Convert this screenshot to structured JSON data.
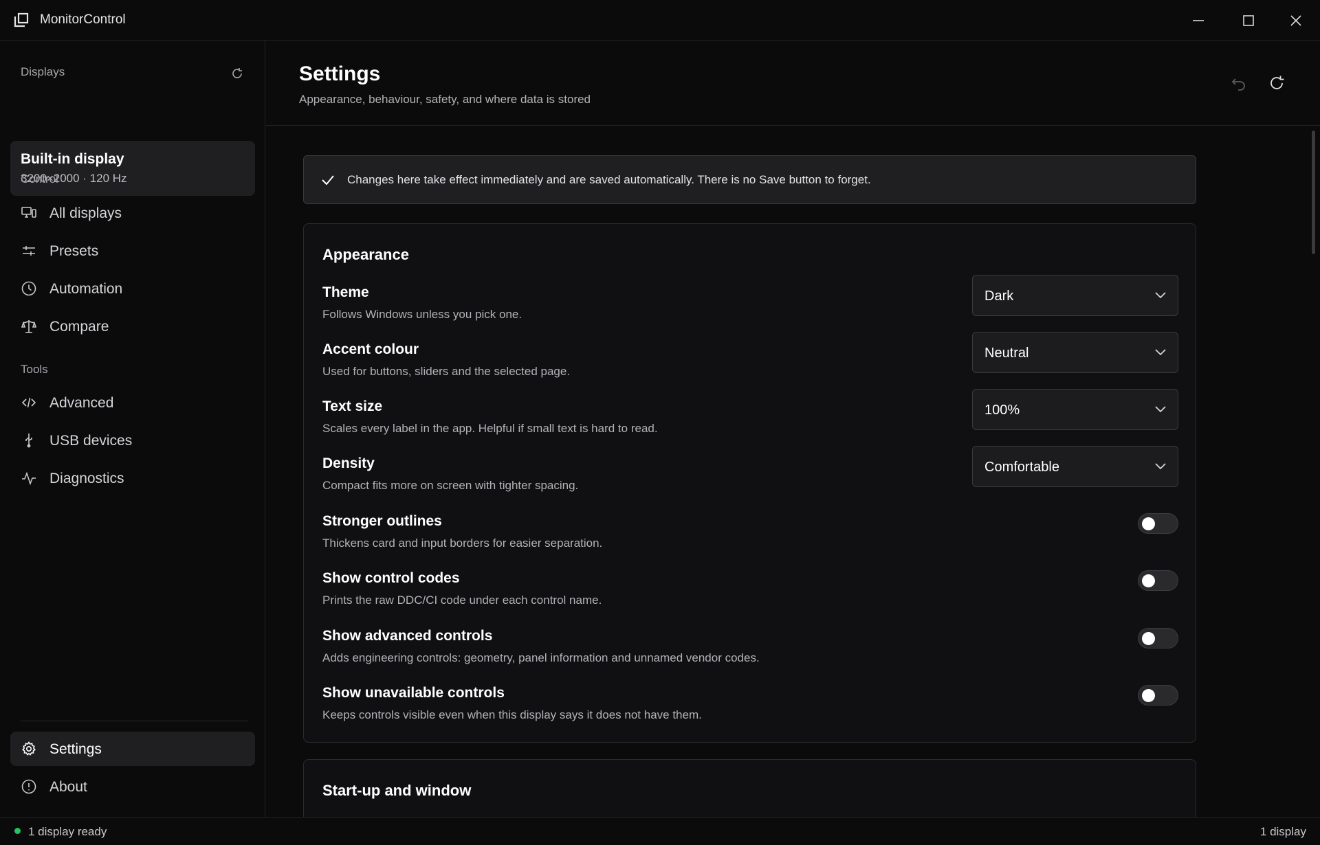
{
  "app": {
    "title": "MonitorControl"
  },
  "sidebar": {
    "displays_label": "Displays",
    "display_card": {
      "name": "Built-in display",
      "meta": "3200×2000  ·  120 Hz"
    },
    "control_label": "Control",
    "control_items": [
      {
        "label": "All displays",
        "icon": "monitors-icon"
      },
      {
        "label": "Presets",
        "icon": "sliders-icon"
      },
      {
        "label": "Automation",
        "icon": "clock-icon"
      },
      {
        "label": "Compare",
        "icon": "scale-icon"
      }
    ],
    "tools_label": "Tools",
    "tools_items": [
      {
        "label": "Advanced",
        "icon": "code-icon"
      },
      {
        "label": "USB devices",
        "icon": "usb-icon"
      },
      {
        "label": "Diagnostics",
        "icon": "pulse-icon"
      }
    ],
    "bottom_items": [
      {
        "label": "Settings",
        "icon": "gear-icon",
        "active": true
      },
      {
        "label": "About",
        "icon": "info-icon"
      }
    ]
  },
  "header": {
    "title": "Settings",
    "subtitle": "Appearance, behaviour, safety, and where data is stored"
  },
  "banner": {
    "text": "Changes here take effect immediately and are saved automatically. There is no Save button to forget."
  },
  "appearance": {
    "title": "Appearance",
    "settings": [
      {
        "label": "Theme",
        "desc": "Follows Windows unless you pick one.",
        "type": "select",
        "value": "Dark"
      },
      {
        "label": "Accent colour",
        "desc": "Used for buttons, sliders and the selected page.",
        "type": "select",
        "value": "Neutral"
      },
      {
        "label": "Text size",
        "desc": "Scales every label in the app. Helpful if small text is hard to read.",
        "type": "select",
        "value": "100%"
      },
      {
        "label": "Density",
        "desc": "Compact fits more on screen with tighter spacing.",
        "type": "select",
        "value": "Comfortable"
      },
      {
        "label": "Stronger outlines",
        "desc": "Thickens card and input borders for easier separation.",
        "type": "toggle",
        "value": false
      },
      {
        "label": "Show control codes",
        "desc": "Prints the raw DDC/CI code under each control name.",
        "type": "toggle",
        "value": false
      },
      {
        "label": "Show advanced controls",
        "desc": "Adds engineering controls: geometry, panel information and unnamed vendor codes.",
        "type": "toggle",
        "value": false
      },
      {
        "label": "Show unavailable controls",
        "desc": "Keeps controls visible even when this display says it does not have them.",
        "type": "toggle",
        "value": false
      }
    ]
  },
  "startup": {
    "title": "Start-up and window"
  },
  "status": {
    "left": "1 display ready",
    "right": "1 display",
    "dot_color": "#22c55e"
  }
}
